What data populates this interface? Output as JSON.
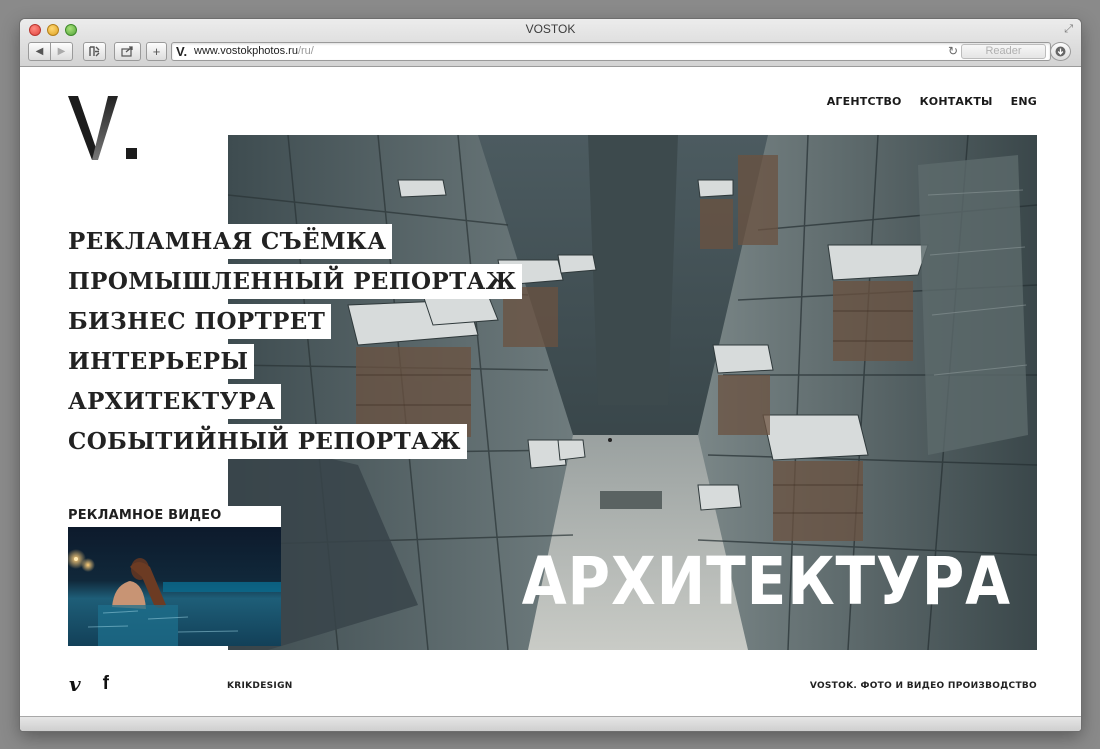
{
  "browser": {
    "window_title": "VOSTOK",
    "favicon_glyph": "V.",
    "url_host": "www.vostokphotos.ru",
    "url_path": "/ru/",
    "reader_label": "Reader",
    "icons": {
      "close": "close-traffic-light",
      "minimize": "minimize-traffic-light",
      "zoom": "zoom-traffic-light",
      "back": "◀",
      "forward": "▶",
      "top_sites": "top-sites-icon",
      "share": "share-icon",
      "add": "+",
      "reload": "↻",
      "downloads": "downloads-icon",
      "fullscreen": "⤢"
    }
  },
  "site": {
    "logo_text": "V.",
    "nav": [
      "АГЕНТСТВО",
      "КОНТАКТЫ",
      "ENG"
    ],
    "menu": [
      "РЕКЛАМНАЯ СЪЁМКА",
      "ПРОМЫШЛЕННЫЙ РЕПОРТАЖ",
      "БИЗНЕС ПОРТРЕТ",
      "ИНТЕРЬЕРЫ",
      "АРХИТЕКТУРА",
      "СОБЫТИЙНЫЙ РЕПОРТАЖ"
    ],
    "hero_caption": "АРХИТЕКТУРА",
    "video_label": "РЕКЛАМНОЕ ВИДЕО",
    "social": {
      "vimeo": "v",
      "facebook": "f"
    },
    "credit": "KRIKDESIGN",
    "tagline": "VOSTOK. ФОТО И ВИДЕО ПРОИЗВОДСТВО"
  },
  "colors": {
    "text": "#1a1a1a",
    "hero_caption": "#ffffff",
    "page_bg": "#ffffff",
    "desktop_bg": "#8a8a8a"
  }
}
